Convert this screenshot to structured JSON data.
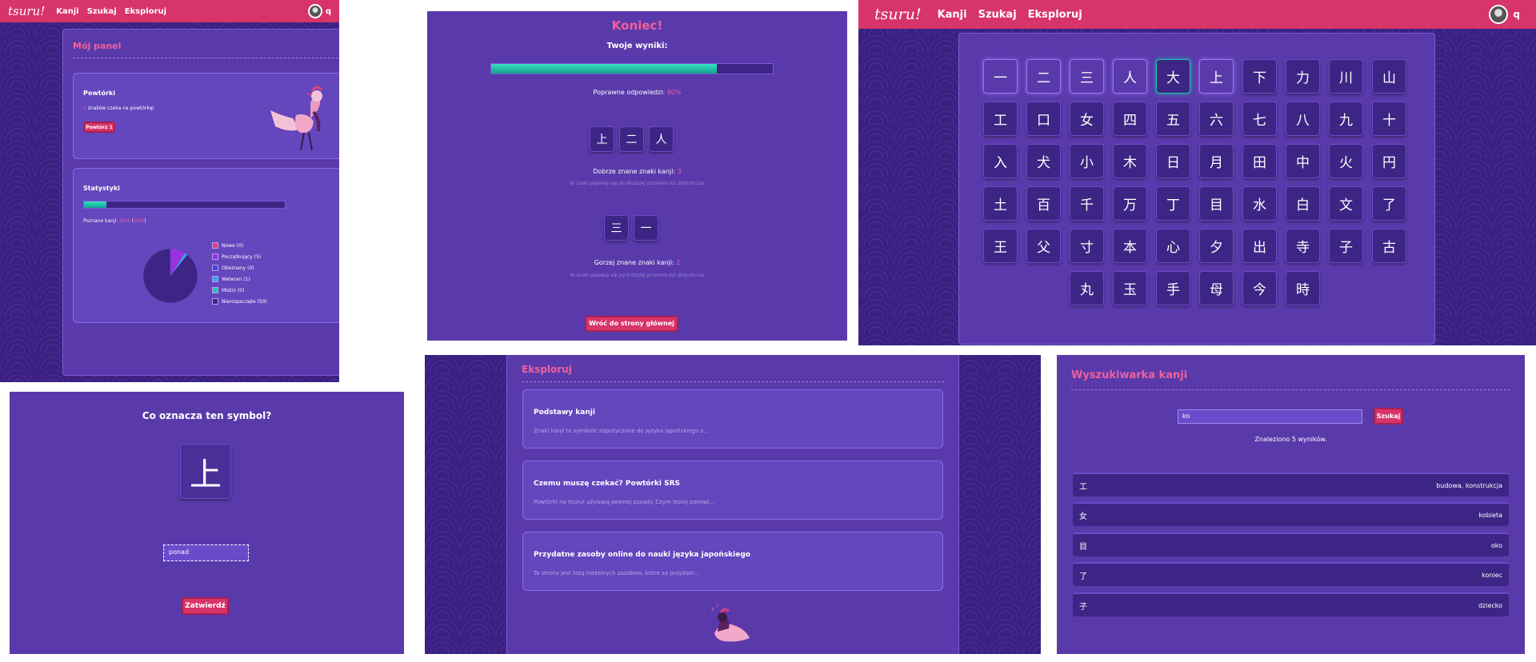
{
  "brand": {
    "logo": "tsuru!",
    "nav": [
      "Kanji",
      "Szukaj",
      "Eksploruj"
    ],
    "user": "q"
  },
  "colors": {
    "accent": "#d7346a",
    "background": "#3a2080",
    "panel": "#5a3aab",
    "progress": "#24c3b0",
    "highlight": "#f0609a"
  },
  "dashboard": {
    "title": "Mój panel",
    "reviews": {
      "heading": "Powtórki",
      "count": "1",
      "text": " znaków czeka na powtórkę!",
      "button": "Powtórz 1"
    },
    "stats": {
      "heading": "Statystyki",
      "known_prefix": "Poznane kanji: ",
      "known": "6/56",
      "percent": "10%",
      "progress": 0.11
    },
    "legend": [
      {
        "label": "Nowe (0)",
        "color": "#e0407a"
      },
      {
        "label": "Początkujący (5)",
        "color": "#9b30e0"
      },
      {
        "label": "Obeznany (0)",
        "color": "#3a4ad8"
      },
      {
        "label": "Weteran (1)",
        "color": "#2fa8e8"
      },
      {
        "label": "Mistrz (0)",
        "color": "#24c3b0"
      },
      {
        "label": "Nierozpoczęte (50)",
        "color": "#3d2585"
      }
    ],
    "chart_data": {
      "type": "pie",
      "categories": [
        "Nowe",
        "Początkujący",
        "Obeznany",
        "Weteran",
        "Mistrz",
        "Nierozpoczęte"
      ],
      "values": [
        0,
        5,
        0,
        1,
        0,
        50
      ]
    }
  },
  "quiz": {
    "question": "Co oznacza ten symbol?",
    "kanji": "上",
    "input_value": "ponad",
    "submit": "Zatwierdź"
  },
  "results": {
    "title": "Koniec!",
    "subtitle": "Twoje wyniki:",
    "progress": 0.8,
    "correct_prefix": "Poprawne odpowiedzi: ",
    "correct_value": "80%",
    "good": {
      "kanji": [
        "上",
        "二",
        "人"
      ],
      "label_prefix": "Dobrze znane znaki kanji: ",
      "count": "3",
      "note": "te znaki pojawią się po dłuższej przerwie niż dotychczas"
    },
    "bad": {
      "kanji": [
        "三",
        "一"
      ],
      "label_prefix": "Gorzej znane znaki kanji: ",
      "count": "2",
      "note": "te znaki pojawią się po krótszej przerwie niż dotychczas"
    },
    "back_button": "Wróć do strony głównej"
  },
  "explore": {
    "title": "Eksploruj",
    "articles": [
      {
        "title": "Podstawy kanji",
        "excerpt": "Znaki kanji to symbole zapożyczone do języka japońskiego z..."
      },
      {
        "title": "Czemu muszę czekać? Powtórki SRS",
        "excerpt": "Powtórki na tsuru! używają pewnej zasady. Czym lepiej pamięt..."
      },
      {
        "title": "Przydatne zasoby online do nauki języka japońskiego",
        "excerpt": "Ta strona jest listą niektórych zasobów, które są przydatn..."
      }
    ]
  },
  "kanji_grid": {
    "rows": [
      [
        "一",
        "二",
        "三",
        "人",
        "大",
        "上",
        "下",
        "力",
        "川",
        "山"
      ],
      [
        "工",
        "口",
        "女",
        "四",
        "五",
        "六",
        "七",
        "八",
        "九",
        "十"
      ],
      [
        "入",
        "犬",
        "小",
        "木",
        "日",
        "月",
        "田",
        "中",
        "火",
        "円"
      ],
      [
        "土",
        "百",
        "千",
        "万",
        "丁",
        "目",
        "水",
        "白",
        "文",
        "了"
      ],
      [
        "王",
        "父",
        "寸",
        "本",
        "心",
        "夕",
        "出",
        "寺",
        "子",
        "古"
      ],
      [
        "丸",
        "玉",
        "手",
        "母",
        "今",
        "時"
      ]
    ],
    "light": [
      "一",
      "二",
      "三",
      "人",
      "上"
    ],
    "teal": [
      "大"
    ]
  },
  "search": {
    "title": "Wyszukiwarka kanji",
    "query": "ko",
    "button": "Szukaj",
    "found": "Znaleziono 5 wyników.",
    "results": [
      {
        "kanji": "工",
        "meaning": "budowa, konstrukcja"
      },
      {
        "kanji": "女",
        "meaning": "kobieta"
      },
      {
        "kanji": "目",
        "meaning": "oko"
      },
      {
        "kanji": "了",
        "meaning": "koniec"
      },
      {
        "kanji": "子",
        "meaning": "dziecko"
      }
    ]
  }
}
